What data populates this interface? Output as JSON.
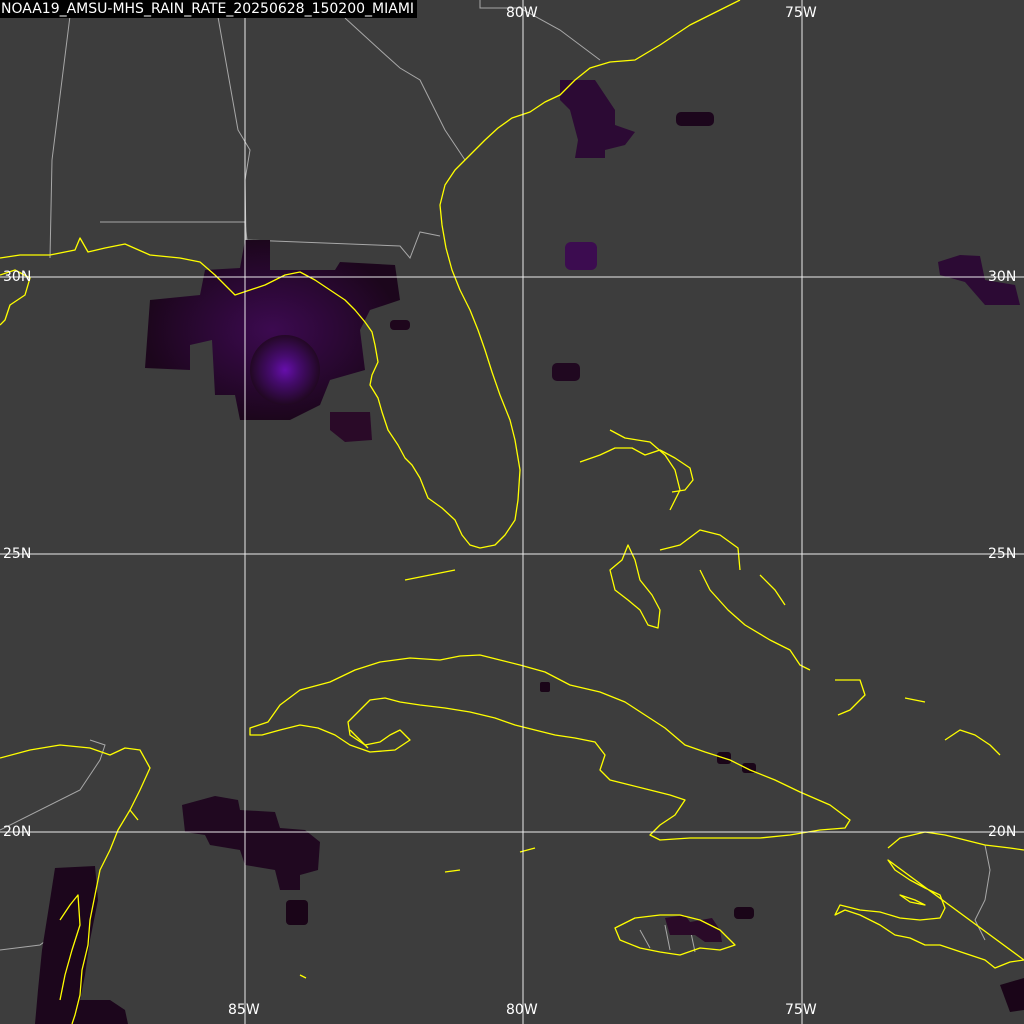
{
  "title": "NOAA19_AMSU-MHS_RAIN_RATE_20250628_150200_MIAMI",
  "colors": {
    "background": "#3d3d3d",
    "coastline": "#ffff00",
    "borders": "#a8a8a8",
    "gridlines": "#ffffff",
    "rain_low": "#1a0518",
    "rain_mid": "#3a0a4a",
    "rain_high": "#6a10b0"
  },
  "grid": {
    "longitudes": [
      "85W",
      "80W",
      "75W"
    ],
    "latitudes": [
      "30N",
      "25N",
      "20N"
    ]
  },
  "labels": {
    "top_80w": "80W",
    "top_75w": "75W",
    "bottom_85w": "85W",
    "bottom_80w": "80W",
    "bottom_75w": "75W",
    "left_30n": "30N",
    "left_25n": "25N",
    "left_20n": "20N",
    "right_30n": "30N",
    "right_25n": "25N",
    "right_20n": "20N"
  },
  "features": {
    "coastline_icon": "coastline",
    "rain_icon": "rain-rate-blob"
  }
}
